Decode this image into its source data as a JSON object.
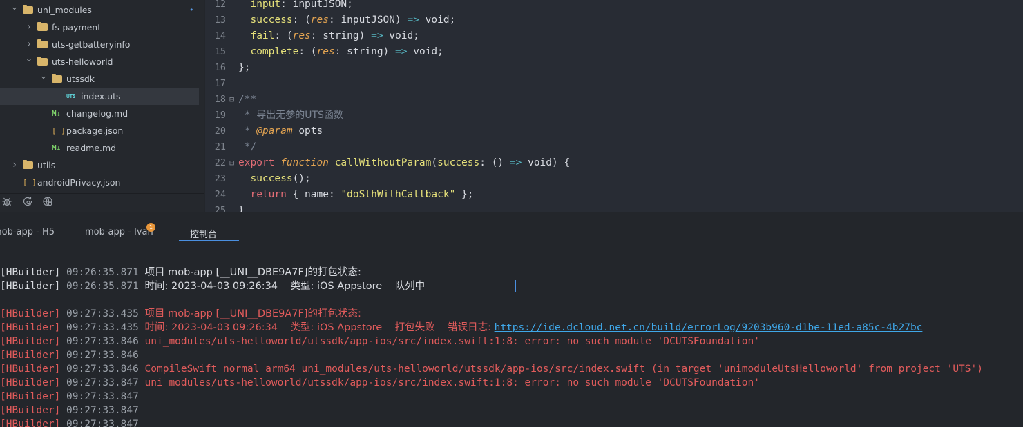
{
  "sidebar": {
    "tree": [
      {
        "label": "uni_modules",
        "type": "folder",
        "expanded": true,
        "depth": 1,
        "modified": true
      },
      {
        "label": "fs-payment",
        "type": "folder",
        "expanded": false,
        "depth": 2
      },
      {
        "label": "uts-getbatteryinfo",
        "type": "folder",
        "expanded": false,
        "depth": 2
      },
      {
        "label": "uts-helloworld",
        "type": "folder",
        "expanded": true,
        "depth": 2
      },
      {
        "label": "utssdk",
        "type": "folder",
        "expanded": true,
        "depth": 3
      },
      {
        "label": "index.uts",
        "type": "uts",
        "depth": 4,
        "selected": true,
        "icon_text": "UTS"
      },
      {
        "label": "changelog.md",
        "type": "md",
        "depth": 3,
        "icon_text": "M↓"
      },
      {
        "label": "package.json",
        "type": "json",
        "depth": 3,
        "icon_text": "[ ]"
      },
      {
        "label": "readme.md",
        "type": "md",
        "depth": 3,
        "icon_text": "M↓"
      },
      {
        "label": "utils",
        "type": "folder",
        "expanded": false,
        "depth": 1
      },
      {
        "label": "androidPrivacy.json",
        "type": "json",
        "depth": 1,
        "icon_text": "[ ]"
      }
    ],
    "modified_dot": "•",
    "bottom_icons": [
      "bug-icon",
      "refresh-search-icon",
      "globe-icon"
    ]
  },
  "editor": {
    "lines": [
      {
        "n": "12",
        "t": [
          [
            "  ",
            "pl"
          ],
          [
            "input",
            "prop"
          ],
          [
            ": inputJSON;",
            "pl"
          ]
        ]
      },
      {
        "n": "13",
        "t": [
          [
            "  ",
            "pl"
          ],
          [
            "success",
            "prop"
          ],
          [
            ": (",
            "pl"
          ],
          [
            "res",
            "ital"
          ],
          [
            ": inputJSON) ",
            "pl"
          ],
          [
            "=>",
            "arrow"
          ],
          [
            " void;",
            "pl"
          ]
        ]
      },
      {
        "n": "14",
        "t": [
          [
            "  ",
            "pl"
          ],
          [
            "fail",
            "prop"
          ],
          [
            ": (",
            "pl"
          ],
          [
            "res",
            "ital"
          ],
          [
            ": string) ",
            "pl"
          ],
          [
            "=>",
            "arrow"
          ],
          [
            " void;",
            "pl"
          ]
        ]
      },
      {
        "n": "15",
        "t": [
          [
            "  ",
            "pl"
          ],
          [
            "complete",
            "prop"
          ],
          [
            ": (",
            "pl"
          ],
          [
            "res",
            "ital"
          ],
          [
            ": string) ",
            "pl"
          ],
          [
            "=>",
            "arrow"
          ],
          [
            " void;",
            "pl"
          ]
        ]
      },
      {
        "n": "16",
        "t": [
          [
            "};",
            "pl"
          ]
        ]
      },
      {
        "n": "17",
        "t": []
      },
      {
        "n": "18",
        "fold": "⊟",
        "t": [
          [
            "/**",
            "cmt"
          ]
        ]
      },
      {
        "n": "19",
        "t": [
          [
            " * ",
            "cmt"
          ],
          [
            "导出无参的UTS函数",
            "cn"
          ]
        ]
      },
      {
        "n": "20",
        "t": [
          [
            " * ",
            "cmt"
          ],
          [
            "@param",
            "ital"
          ],
          [
            " opts",
            "pl"
          ]
        ]
      },
      {
        "n": "21",
        "t": [
          [
            " */",
            "cmt"
          ]
        ]
      },
      {
        "n": "22",
        "fold": "⊟",
        "t": [
          [
            "export",
            "kw"
          ],
          [
            " ",
            "pl"
          ],
          [
            "function",
            "ital"
          ],
          [
            " ",
            "pl"
          ],
          [
            "callWithoutParam",
            "fn"
          ],
          [
            "(",
            "pl"
          ],
          [
            "success",
            "prop"
          ],
          [
            ": () ",
            "pl"
          ],
          [
            "=>",
            "arrow"
          ],
          [
            " void) {",
            "pl"
          ]
        ]
      },
      {
        "n": "23",
        "t": [
          [
            "  ",
            "pl"
          ],
          [
            "success",
            "prop"
          ],
          [
            "();",
            "pl"
          ]
        ]
      },
      {
        "n": "24",
        "t": [
          [
            "  ",
            "pl"
          ],
          [
            "return",
            "kw"
          ],
          [
            " { name: ",
            "pl"
          ],
          [
            "\"doSthWithCallback\"",
            "str"
          ],
          [
            " };",
            "pl"
          ]
        ]
      },
      {
        "n": "25",
        "t": [
          [
            "}",
            "pl"
          ]
        ]
      }
    ]
  },
  "panel": {
    "tabs": [
      {
        "label": "mob-app - H5",
        "active": false
      },
      {
        "label": "mob-app - Ivan",
        "active": false,
        "badge": "1"
      },
      {
        "label": "控制台",
        "active": true
      }
    ],
    "logs": [
      {
        "row": 0,
        "segs": [
          [
            "[HBuilder]",
            "white"
          ],
          [
            " 09:26:35.871 ",
            "gray"
          ],
          [
            "项目 mob-app [__UNI__DBE9A7F]的打包状态:",
            "white"
          ]
        ]
      },
      {
        "row": 1,
        "segs": [
          [
            "[HBuilder]",
            "white"
          ],
          [
            " 09:26:35.871 ",
            "gray"
          ],
          [
            "时间: 2023-04-03 09:26:34    类型: iOS Appstore    队列中",
            "white"
          ]
        ]
      },
      {
        "row": 3,
        "segs": [
          [
            "[HBuilder]",
            "red"
          ],
          [
            " 09:27:33.435 ",
            "gray"
          ],
          [
            "项目 mob-app [__UNI__DBE9A7F]的打包状态:",
            "red"
          ]
        ]
      },
      {
        "row": 4,
        "segs": [
          [
            "[HBuilder]",
            "red"
          ],
          [
            " 09:27:33.435 ",
            "gray"
          ],
          [
            "时间: 2023-04-03 09:26:34    类型: iOS Appstore    打包失败    错误日志: ",
            "red"
          ],
          [
            "https://ide.dcloud.net.cn/build/errorLog/9203b960-d1be-11ed-a85c-4b27bc",
            "link"
          ]
        ]
      },
      {
        "row": 5,
        "segs": [
          [
            "[HBuilder]",
            "red"
          ],
          [
            " 09:27:33.846 ",
            "gray"
          ],
          [
            "uni_modules/uts-helloworld/utssdk/app-ios/src/index.swift:1:8: error: no such module 'DCUTSFoundation'",
            "red"
          ]
        ]
      },
      {
        "row": 6,
        "segs": [
          [
            "[HBuilder]",
            "red"
          ],
          [
            " 09:27:33.846",
            "gray"
          ]
        ]
      },
      {
        "row": 7,
        "segs": [
          [
            "[HBuilder]",
            "red"
          ],
          [
            " 09:27:33.846 ",
            "gray"
          ],
          [
            "CompileSwift normal arm64 uni_modules/uts-helloworld/utssdk/app-ios/src/index.swift (in target 'unimoduleUtsHelloworld' from project 'UTS')",
            "red"
          ]
        ]
      },
      {
        "row": 8,
        "segs": [
          [
            "[HBuilder]",
            "red"
          ],
          [
            " 09:27:33.847 ",
            "gray"
          ],
          [
            "uni_modules/uts-helloworld/utssdk/app-ios/src/index.swift:1:8: error: no such module 'DCUTSFoundation'",
            "red"
          ]
        ]
      },
      {
        "row": 9,
        "segs": [
          [
            "[HBuilder]",
            "red"
          ],
          [
            " 09:27:33.847",
            "gray"
          ]
        ]
      },
      {
        "row": 10,
        "segs": [
          [
            "[HBuilder]",
            "red"
          ],
          [
            " 09:27:33.847",
            "gray"
          ]
        ]
      },
      {
        "row": 11,
        "segs": [
          [
            "[HBuilder]",
            "red"
          ],
          [
            " 09:27:33.847",
            "gray"
          ]
        ]
      }
    ]
  }
}
